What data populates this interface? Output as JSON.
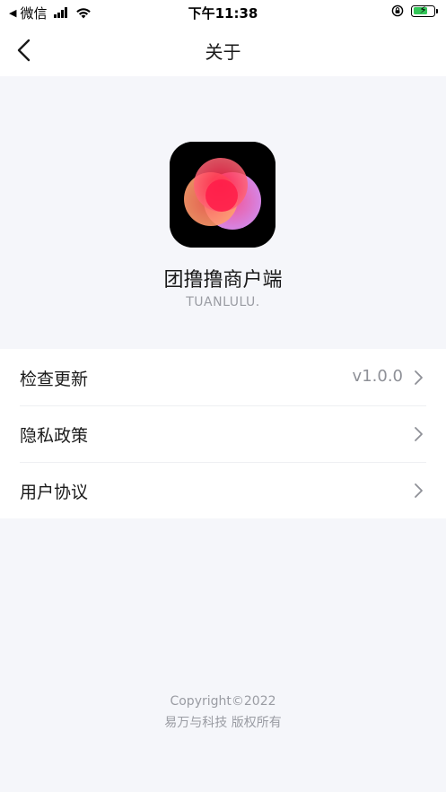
{
  "status_bar": {
    "carrier": "微信",
    "time": "下午11:38",
    "icons": [
      "back-triangle-icon",
      "signal-icon",
      "wifi-icon",
      "orientation-lock-icon",
      "battery-charging-icon"
    ],
    "battery_color": "#34c759"
  },
  "nav": {
    "title": "关于",
    "back_icon": "chevron-left-icon"
  },
  "app": {
    "name": "团撸撸商户端",
    "subtitle": "TUANLULU.",
    "icon": "app-logo-icon",
    "icon_colors": [
      "#000000",
      "#ff2d55",
      "#ff9a6b",
      "#e08cf0"
    ]
  },
  "menu": {
    "items": [
      {
        "label": "检查更新",
        "value": "v1.0.0"
      },
      {
        "label": "隐私政策",
        "value": ""
      },
      {
        "label": "用户协议",
        "value": ""
      }
    ],
    "chevron_icon": "chevron-right-icon"
  },
  "footer": {
    "copyright": "Copyright©2022",
    "company": "易万与科技 版权所有"
  },
  "colors": {
    "background": "#f5f6fa",
    "card": "#ffffff",
    "text_primary": "#1a1a1a",
    "text_secondary": "#9a9ca3"
  }
}
